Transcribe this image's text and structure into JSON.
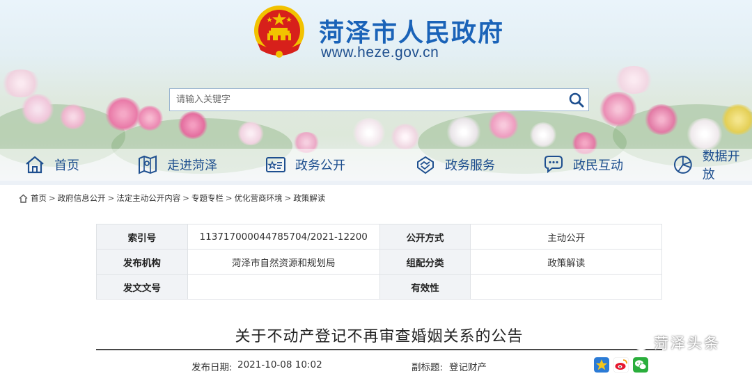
{
  "header": {
    "site_title": "菏泽市人民政府",
    "site_url": "www.heze.gov.cn",
    "search_placeholder": "请输入关键字"
  },
  "nav": [
    {
      "label": "首页",
      "icon": "home-icon"
    },
    {
      "label": "走进菏泽",
      "icon": "map-icon"
    },
    {
      "label": "政务公开",
      "icon": "info-board-icon"
    },
    {
      "label": "政务服务",
      "icon": "handshake-icon"
    },
    {
      "label": "政民互动",
      "icon": "chat-icon"
    },
    {
      "label": "数据开放",
      "icon": "data-icon"
    }
  ],
  "breadcrumb": [
    "首页",
    "政府信息公开",
    "法定主动公开内容",
    "专题专栏",
    "优化营商环境",
    "政策解读"
  ],
  "info_table": {
    "index_label": "索引号",
    "index_value": "113717000044785704/2021-12200",
    "mode_label": "公开方式",
    "mode_value": "主动公开",
    "org_label": "发布机构",
    "org_value": "菏泽市自然资源和规划局",
    "category_label": "组配分类",
    "category_value": "政策解读",
    "docno_label": "发文文号",
    "docno_value": "",
    "validity_label": "有效性",
    "validity_value": ""
  },
  "article": {
    "title": "关于不动产登记不再审查婚姻关系的公告",
    "publish_label": "发布日期:",
    "publish_date": "2021-10-08 10:02",
    "subtitle_label": "副标题:",
    "subtitle": "登记财产"
  },
  "share_icons": [
    "qzone-icon",
    "weibo-icon",
    "wechat-icon"
  ],
  "watermark": "菏泽头条",
  "colors": {
    "brand_blue": "#1a63b8",
    "nav_text": "#1e4f8f",
    "emblem_red": "#d7201b",
    "emblem_gold": "#f2c200"
  }
}
